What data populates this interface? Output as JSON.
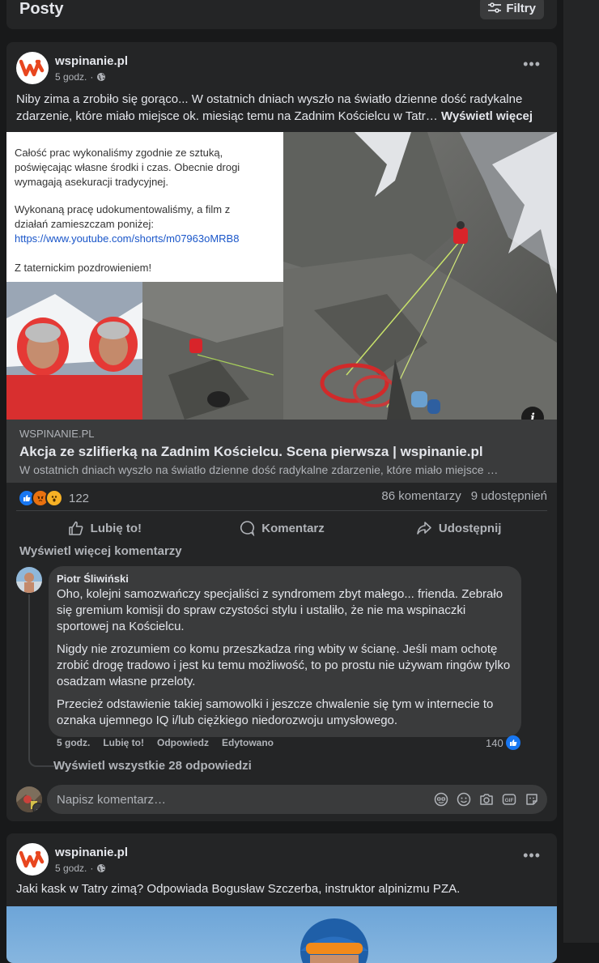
{
  "header": {
    "title": "Posty",
    "filter_label": "Filtry"
  },
  "post1": {
    "author": "wspinanie.pl",
    "time": "5 godz.",
    "text": "Niby zima a zrobiło się gorąco... W ostatnich dniach wyszło na światło dzienne dość radykalne zdarzenie, które miało miejsce ok. miesiąc temu na Zadnim Kościelcu w Tatr…",
    "see_more": "Wyświetl więcej",
    "image_text": {
      "line1": "Całość prac wykonaliśmy zgodnie ze sztuką,",
      "line2": "poświęcając własne środki i czas. Obecnie drogi",
      "line3": "wymagają asekuracji tradycyjnej.",
      "line4": "Wykonaną pracę udokumentowaliśmy, a film z",
      "line5": "działań zamieszczam poniżej:",
      "link": "https://www.youtube.com/shorts/m07963oMRB8",
      "line6": "Z taternickim pozdrowieniem!"
    },
    "link": {
      "domain": "WSPINANIE.PL",
      "title": "Akcja ze szlifierką na Zadnim Kościelcu. Scena pierwsza | wspinanie.pl",
      "description": "W ostatnich dniach wyszło na światło dzienne dość radykalne zdarzenie, które miało miejsce …"
    },
    "reactions_count": "122",
    "comments_count": "86 komentarzy",
    "shares_count": "9 udostępnień",
    "actions": {
      "like": "Lubię to!",
      "comment": "Komentarz",
      "share": "Udostępnij"
    },
    "more_comments": "Wyświetl więcej komentarzy",
    "comment": {
      "author": "Piotr Śliwiński",
      "paragraphs": [
        "Oho, kolejni samozwańczy specjaliści z syndromem zbyt małego... frienda. Zebrało się gremium komisji do spraw czystości stylu i ustaliło, że nie ma wspinaczki sportowej na Kościelcu.",
        "Nigdy nie zrozumiem co komu przeszkadza ring wbity w ścianę. Jeśli mam ochotę zrobić drogę tradowo i jest ku temu możliwość, to po prostu nie używam ringów tylko osadzam własne przeloty.",
        "Przecież odstawienie takiej samowolki i jeszcze chwalenie się tym w internecie to oznaka ujemnego IQ i/lub ciężkiego niedorozwoju umysłowego."
      ],
      "time": "5 godz.",
      "like": "Lubię to!",
      "reply": "Odpowiedz",
      "edited": "Edytowano",
      "likes": "140"
    },
    "all_replies": "Wyświetl wszystkie 28 odpowiedzi",
    "comment_placeholder": "Napisz komentarz…"
  },
  "post2": {
    "author": "wspinanie.pl",
    "time": "5 godz.",
    "text": "Jaki kask w Tatry zimą? Odpowiada Bogusław Szczerba, instruktor alpinizmu PZA."
  },
  "colors": {
    "background": "#18191a",
    "card": "#242526",
    "accent_blue": "#1877f2",
    "brand_red": "#e8461f"
  },
  "icons": [
    "filter-icon",
    "globe-icon",
    "more-icon",
    "info-icon",
    "like-icon",
    "comment-icon",
    "share-icon",
    "avatar-icon",
    "sticker-icon",
    "emoji-icon",
    "camera-icon",
    "gif-icon",
    "avatar-sticker-icon"
  ]
}
